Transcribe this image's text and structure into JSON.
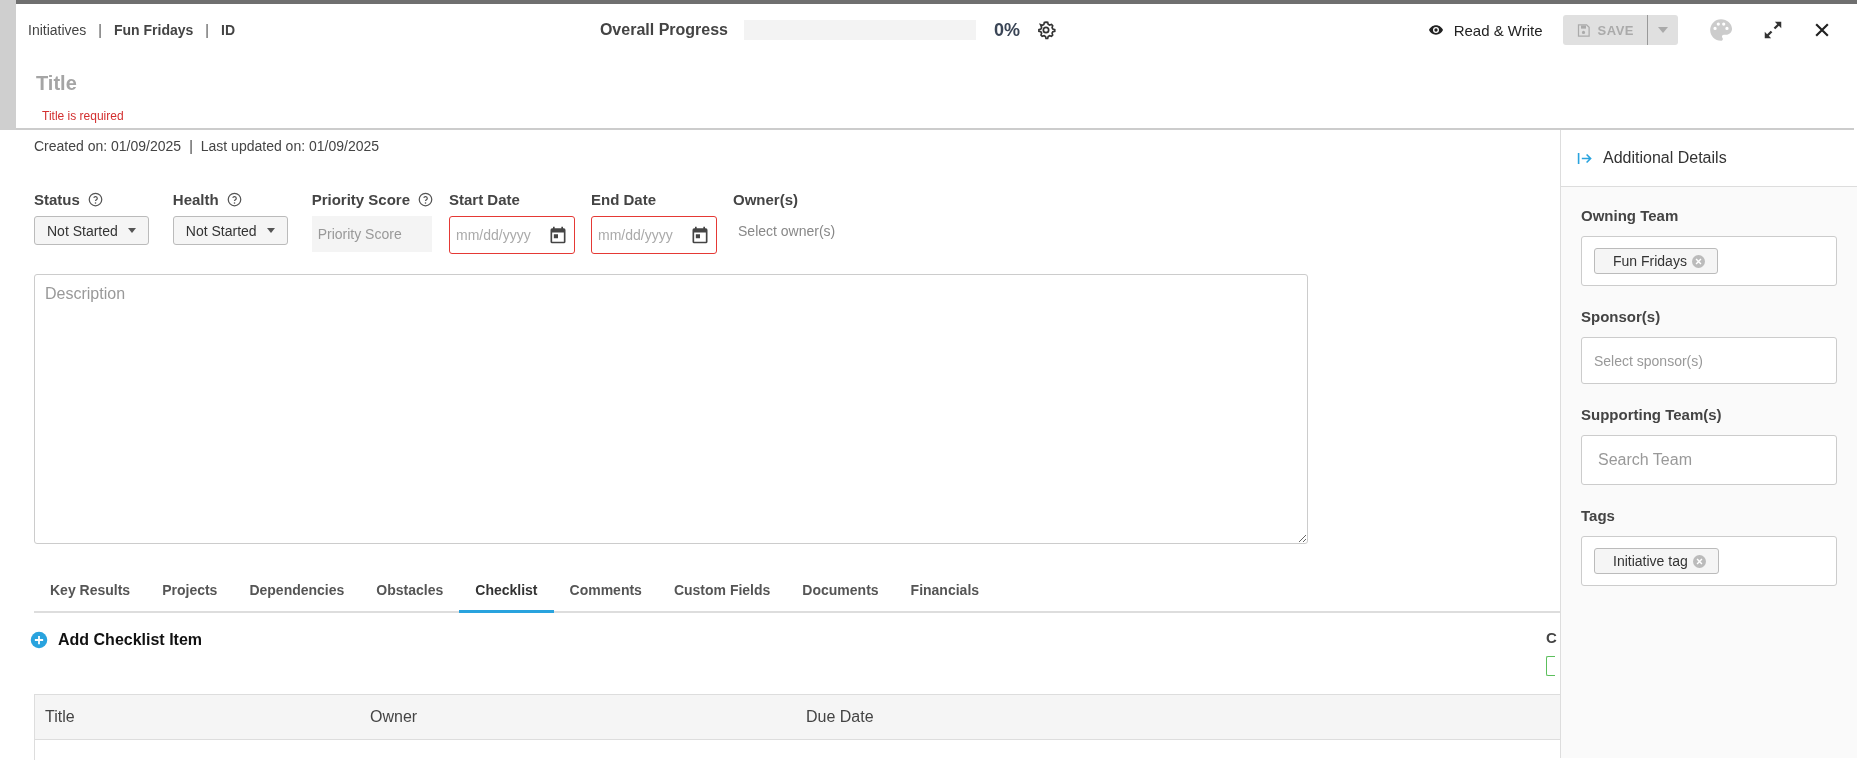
{
  "breadcrumb": [
    {
      "kind": "link",
      "label": "Initiatives",
      "current": false
    },
    {
      "kind": "separator",
      "label": "|"
    },
    {
      "kind": "link",
      "label": "Fun Fridays",
      "current": true
    },
    {
      "kind": "separator",
      "label": "|"
    },
    {
      "kind": "link",
      "label": "ID",
      "current": true
    }
  ],
  "progress": {
    "label": "Overall Progress",
    "level": 0,
    "reading": "0%"
  },
  "access": {
    "label": "Read & Write"
  },
  "save_button": {
    "label": "SAVE",
    "disabled": true
  },
  "title_field": {
    "placeholder": "Title",
    "error": "Title is required"
  },
  "meta": {
    "created": "Created on: 01/09/2025",
    "separator": "|",
    "updated": "Last updated on: 01/09/2025"
  },
  "fields": [
    {
      "kind": "select",
      "label": "Status",
      "help": true,
      "value": "Not Started"
    },
    {
      "kind": "select",
      "label": "Health",
      "help": true,
      "value": "Not Started"
    },
    {
      "kind": "readonly",
      "label": "Priority Score",
      "help": true,
      "placeholder": "Priority Score"
    },
    {
      "kind": "date",
      "label": "Start Date",
      "help": false,
      "placeholder": "mm/dd/yyyy",
      "invalid": true
    },
    {
      "kind": "date",
      "label": "End Date",
      "help": false,
      "placeholder": "mm/dd/yyyy",
      "invalid": true
    },
    {
      "kind": "people",
      "label": "Owner(s)",
      "help": false,
      "placeholder": "Select owner(s)"
    }
  ],
  "description": {
    "placeholder": "Description"
  },
  "tabs": [
    {
      "label": "Key Results",
      "selected": false
    },
    {
      "label": "Projects",
      "selected": false
    },
    {
      "label": "Dependencies",
      "selected": false
    },
    {
      "label": "Obstacles",
      "selected": false
    },
    {
      "label": "Checklist",
      "selected": true
    },
    {
      "label": "Comments",
      "selected": false
    },
    {
      "label": "Custom Fields",
      "selected": false
    },
    {
      "label": "Documents",
      "selected": false
    },
    {
      "label": "Financials",
      "selected": false
    }
  ],
  "checklist": {
    "add_label": "Add Checklist Item",
    "side_heading": "C",
    "columns": [
      "Title",
      "Owner",
      "Due Date"
    ]
  },
  "details_panel": {
    "title": "Additional Details",
    "sections": [
      {
        "kind": "chips",
        "label": "Owning Team",
        "chips": [
          "Fun Fridays"
        ]
      },
      {
        "kind": "select",
        "label": "Sponsor(s)",
        "placeholder": "Select sponsor(s)"
      },
      {
        "kind": "search",
        "label": "Supporting Team(s)",
        "placeholder": "Search Team"
      },
      {
        "kind": "chips",
        "label": "Tags",
        "chips": [
          "Initiative tag"
        ]
      }
    ]
  }
}
